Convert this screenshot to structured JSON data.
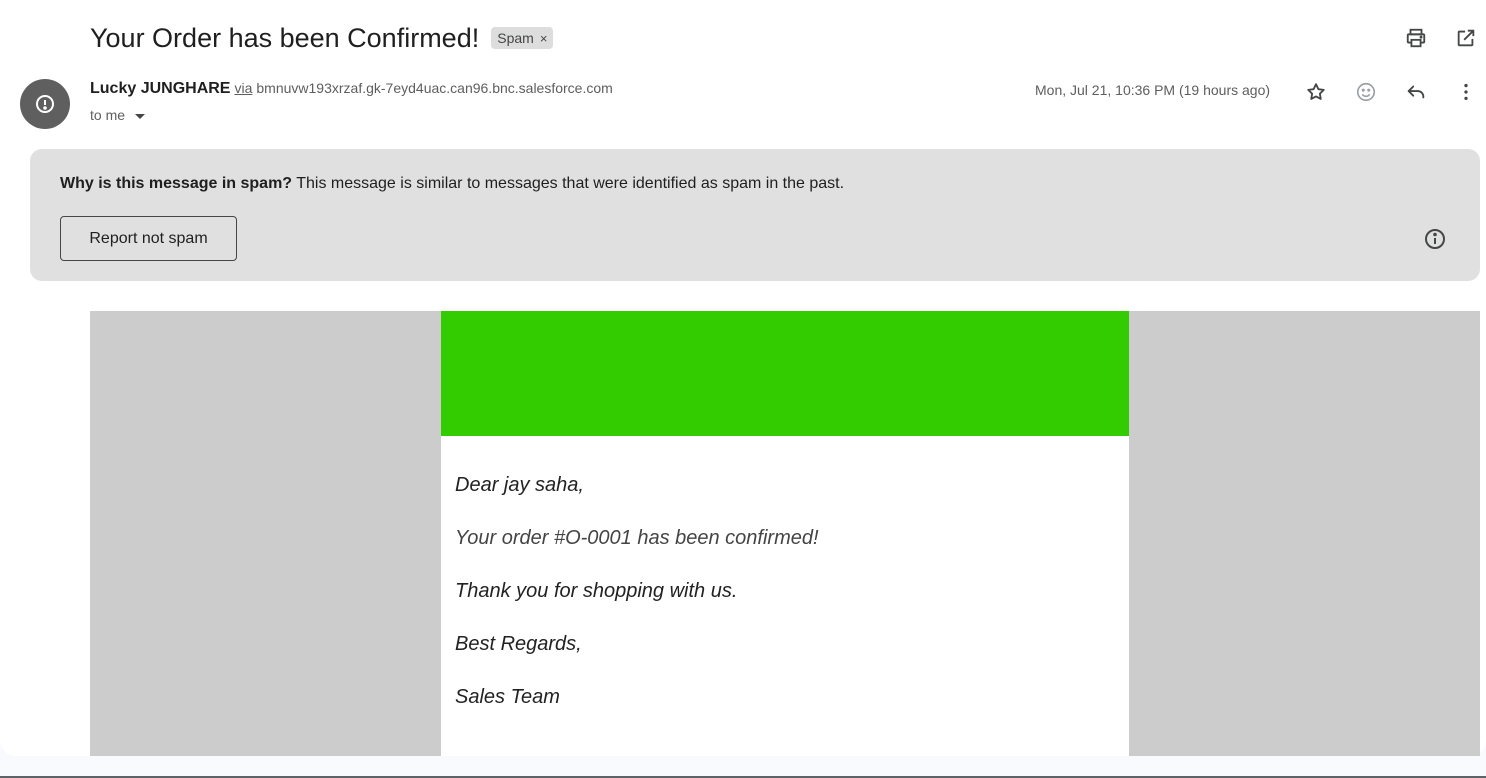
{
  "subject": {
    "title": "Your Order has been Confirmed!",
    "label_chip": "Spam",
    "chip_close": "×"
  },
  "sender": {
    "name": "Lucky JUNGHARE",
    "via_label": "via",
    "via_domain": "bmnuvw193xrzaf.gk-7eyd4uac.can96.bnc.salesforce.com",
    "recipient": "to me",
    "date": "Mon, Jul 21, 10:36 PM (19 hours ago)"
  },
  "spam_banner": {
    "question": "Why is this message in spam?",
    "explanation": "This message is similar to messages that were identified as spam in the past.",
    "report_button": "Report not spam"
  },
  "email_body": {
    "greeting": "Dear jay saha,",
    "line1": "Your order #O-0001 has been confirmed!",
    "line2": "Thank you for shopping with us.",
    "closing": "Best Regards,",
    "signature": "Sales Team"
  },
  "colors": {
    "header_banner": "#33cc00",
    "email_background": "#cccccc",
    "spam_banner_bg": "#e0e0e0",
    "avatar_bg": "#5f5f5f"
  },
  "icons": {
    "top": [
      "print-icon",
      "open-in-new-window-icon"
    ],
    "message": [
      "star-icon",
      "emoji-reaction-icon",
      "reply-icon",
      "more-vertical-icon"
    ],
    "avatar": "alert-icon",
    "banner": "info-icon"
  }
}
